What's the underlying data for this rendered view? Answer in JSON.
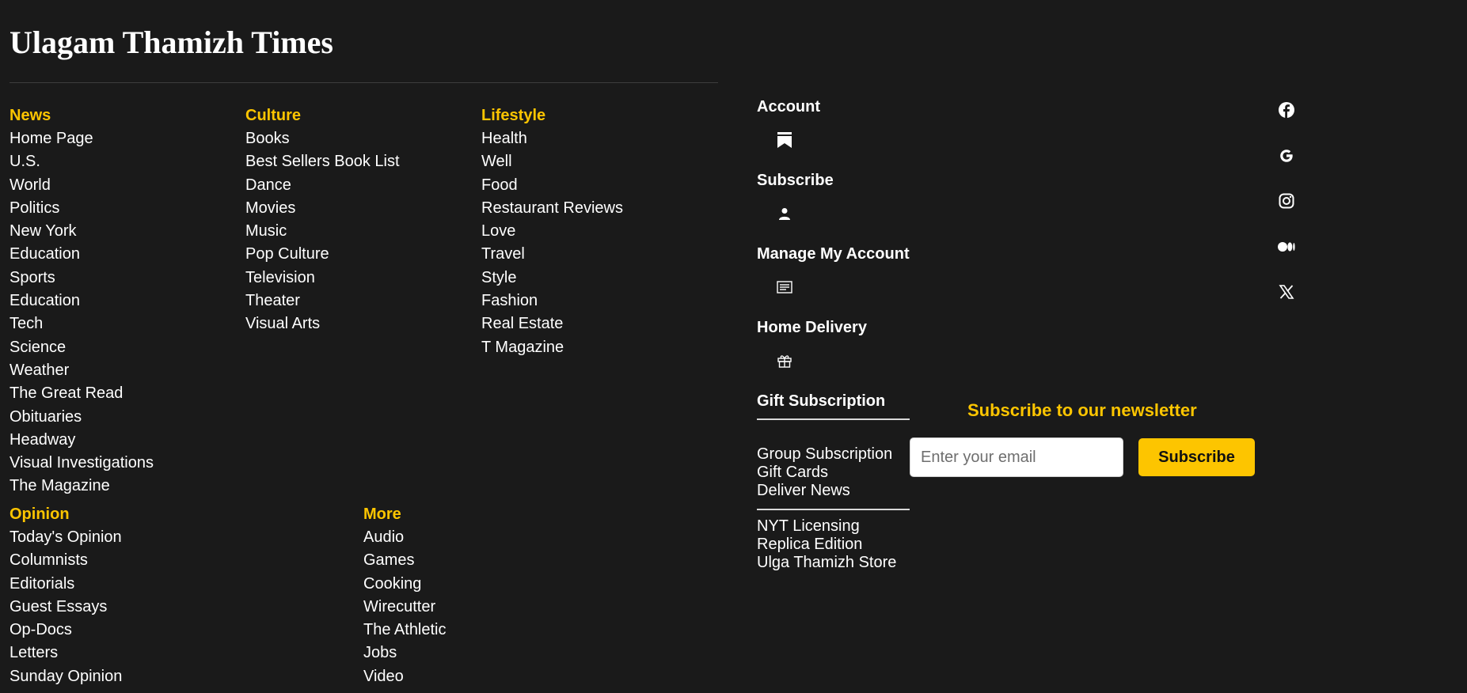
{
  "site": {
    "title": "Ulagam Thamizh Times"
  },
  "sections": {
    "news": {
      "heading": "News",
      "items": [
        "Home Page",
        "U.S.",
        "World",
        "Politics",
        "New York",
        "Education",
        "Sports",
        "Education",
        "Tech",
        "Science",
        "Weather",
        "The Great Read",
        "Obituaries",
        "Headway",
        "Visual Investigations",
        "The Magazine"
      ]
    },
    "culture": {
      "heading": "Culture",
      "items": [
        "Books",
        "Best Sellers Book List",
        "Dance",
        "Movies",
        "Music",
        "Pop Culture",
        "Television",
        "Theater",
        "Visual Arts"
      ]
    },
    "lifestyle": {
      "heading": "Lifestyle",
      "items": [
        "Health",
        "Well",
        "Food",
        "Restaurant Reviews",
        "Love",
        "Travel",
        "Style",
        "Fashion",
        "Real Estate",
        "T Magazine"
      ]
    },
    "opinion": {
      "heading": "Opinion",
      "items": [
        "Today's Opinion",
        "Columnists",
        "Editorials",
        "Guest Essays",
        "Op-Docs",
        "Letters",
        "Sunday Opinion"
      ]
    },
    "more": {
      "heading": "More",
      "items": [
        "Audio",
        "Games",
        "Cooking",
        "Wirecutter",
        "The Athletic",
        "Jobs",
        "Video"
      ]
    }
  },
  "account": {
    "items": [
      {
        "label": "Account",
        "icon": "bookmark-icon"
      },
      {
        "label": "Subscribe",
        "icon": "user-icon"
      },
      {
        "label": "Manage My Account",
        "icon": "newspaper-icon"
      },
      {
        "label": "Home Delivery",
        "icon": "gift-icon"
      }
    ],
    "last_label": "Gift Subscription",
    "group1": [
      "Group Subscription",
      "Gift Cards",
      "Deliver News"
    ],
    "group2": [
      "NYT Licensing",
      "Replica Edition",
      "Ulga Thamizh Store"
    ]
  },
  "social": {
    "icons": [
      "facebook-icon",
      "google-icon",
      "instagram-icon",
      "medium-icon",
      "x-icon"
    ]
  },
  "newsletter": {
    "title": "Subscribe to our newsletter",
    "email_placeholder": "Enter your email",
    "email_value": "",
    "button_label": "Subscribe"
  },
  "colors": {
    "background": "#1a1a1a",
    "accent": "#fdc500",
    "text": "#ffffff"
  }
}
